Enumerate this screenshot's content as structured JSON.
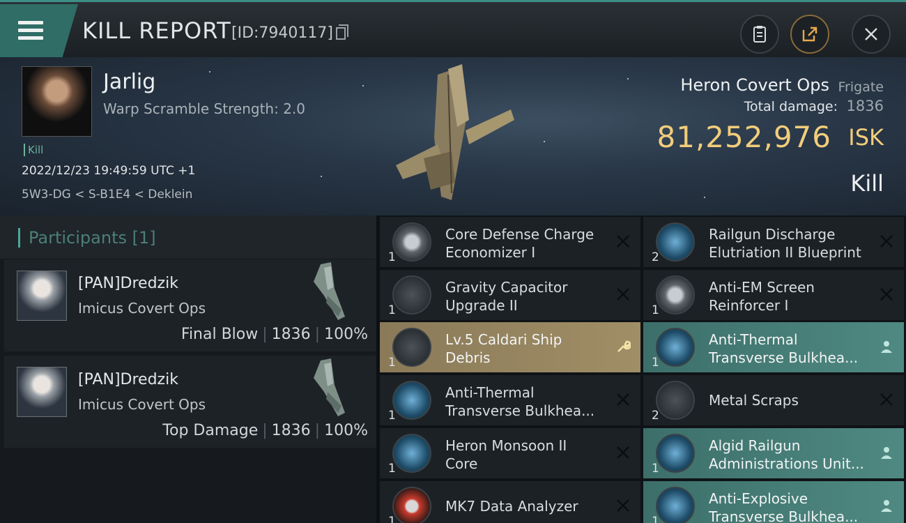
{
  "header": {
    "title": "KILL REPORT",
    "report_id": "[ID:7940117]"
  },
  "victim": {
    "name": "Jarlig",
    "subtitle": "Warp Scramble Strength: 2.0",
    "tag": "Kill",
    "timestamp": "2022/12/23 19:49:59 UTC +1",
    "location": "5W3-DG < S-B1E4 < Deklein",
    "ship_name": "Heron Covert Ops",
    "ship_class": "Frigate",
    "total_damage_label": "Total damage:",
    "total_damage": "1836",
    "isk_value": "81,252,976",
    "isk_unit": "ISK",
    "result": "Kill"
  },
  "participants": {
    "title": "Participants [1]",
    "cards": [
      {
        "name": "[PAN]Dredzik",
        "ship": "Imicus Covert Ops",
        "role": "Final Blow",
        "damage": "1836",
        "percent": "100%"
      },
      {
        "name": "[PAN]Dredzik",
        "ship": "Imicus Covert Ops",
        "role": "Top Damage",
        "damage": "1836",
        "percent": "100%"
      }
    ]
  },
  "items": [
    {
      "name": "Core Defense Charge\nEconomizer I",
      "qty": "1",
      "icon": "shield-module-icon",
      "mark": "destroyed"
    },
    {
      "name": "Railgun Discharge\nElutriation II Blueprint",
      "qty": "2",
      "icon": "blueprint-icon",
      "mark": "destroyed"
    },
    {
      "name": "Gravity Capacitor\nUpgrade II",
      "qty": "1",
      "icon": "rig-icon",
      "mark": "destroyed"
    },
    {
      "name": "Anti-EM Screen\nReinforcer I",
      "qty": "1",
      "icon": "shield-module-icon",
      "mark": "destroyed"
    },
    {
      "name": "Lv.5 Caldari Ship\nDebris",
      "qty": "1",
      "icon": "debris-icon",
      "mark": "salvage"
    },
    {
      "name": "Anti-Thermal\nTransverse Bulkhea...",
      "qty": "1",
      "icon": "blueprint-icon",
      "mark": "dropped"
    },
    {
      "name": "Anti-Thermal\nTransverse Bulkhea...",
      "qty": "1",
      "icon": "blueprint-icon",
      "mark": "destroyed"
    },
    {
      "name": "Metal Scraps",
      "qty": "2",
      "icon": "scrap-icon",
      "mark": "destroyed"
    },
    {
      "name": "Heron Monsoon II\nCore",
      "qty": "1",
      "icon": "core-icon",
      "mark": "destroyed"
    },
    {
      "name": "Algid Railgun\nAdministrations Unit...",
      "qty": "1",
      "icon": "blueprint-icon",
      "mark": "dropped"
    },
    {
      "name": "MK7 Data Analyzer",
      "qty": "1",
      "icon": "data-analyzer-icon",
      "mark": "destroyed"
    },
    {
      "name": "Anti-Explosive\nTransverse Bulkhea...",
      "qty": "1",
      "icon": "blueprint-icon",
      "mark": "dropped"
    }
  ]
}
